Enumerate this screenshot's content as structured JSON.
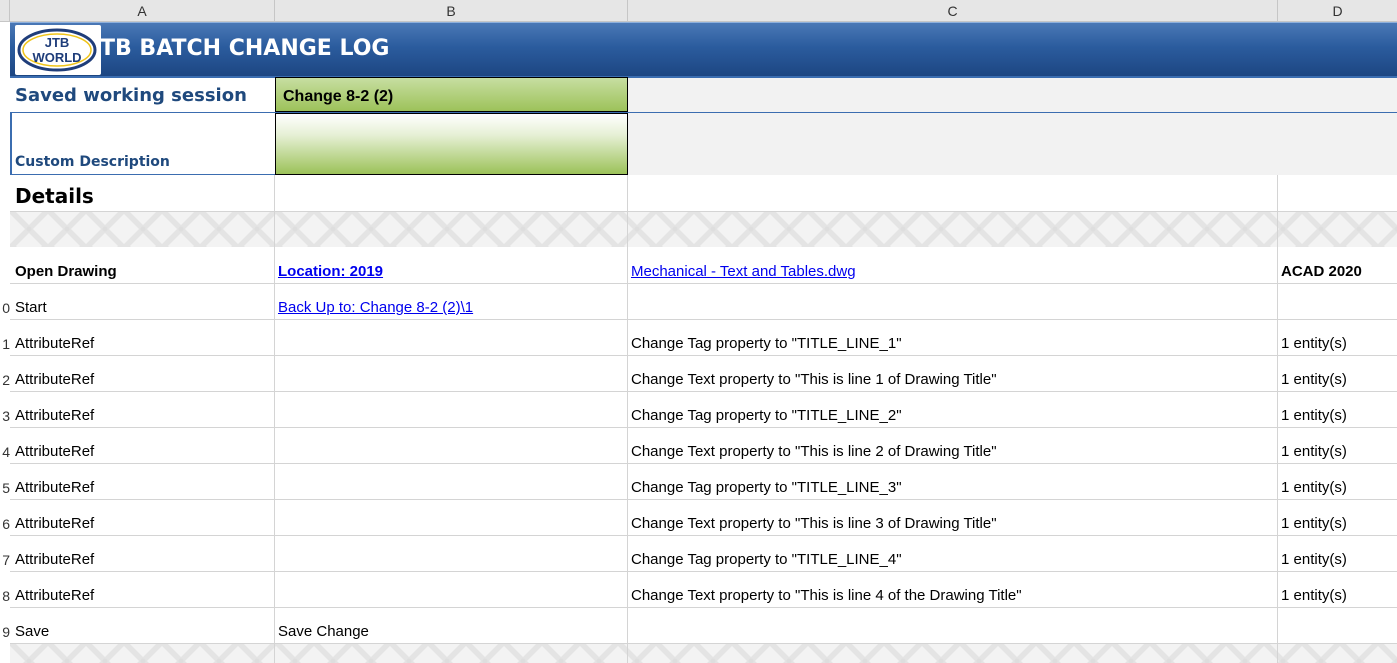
{
  "columns": [
    "A",
    "B",
    "C",
    "D"
  ],
  "banner": {
    "title": "TB BATCH CHANGE LOG",
    "logo_line1": "JTB",
    "logo_line2": "WORLD"
  },
  "session": {
    "label": "Saved working session",
    "value": "Change 8-2 (2)"
  },
  "custom_description": {
    "label": "Custom Description",
    "value": ""
  },
  "details_heading": "Details",
  "open_row": {
    "a": "Open Drawing",
    "b": "Location: 2019",
    "c": "Mechanical - Text and Tables.dwg",
    "d": "ACAD 2020"
  },
  "start_row": {
    "num": "0",
    "a": "Start",
    "b": "Back Up to: Change 8-2 (2)\\1"
  },
  "attr_rows": [
    {
      "num": "1",
      "a": "AttributeRef",
      "c": "Change Tag property to \"TITLE_LINE_1\"",
      "d": "1 entity(s)"
    },
    {
      "num": "2",
      "a": "AttributeRef",
      "c": "Change Text property to \"This is line 1 of Drawing Title\"",
      "d": "1 entity(s)"
    },
    {
      "num": "3",
      "a": "AttributeRef",
      "c": "Change Tag property to \"TITLE_LINE_2\"",
      "d": "1 entity(s)"
    },
    {
      "num": "4",
      "a": "AttributeRef",
      "c": "Change Text property to \"This is line 2 of Drawing Title\"",
      "d": "1 entity(s)"
    },
    {
      "num": "5",
      "a": "AttributeRef",
      "c": "Change Tag property to \"TITLE_LINE_3\"",
      "d": "1 entity(s)"
    },
    {
      "num": "6",
      "a": "AttributeRef",
      "c": "Change Text property to \"This is line 3 of Drawing Title\"",
      "d": "1 entity(s)"
    },
    {
      "num": "7",
      "a": "AttributeRef",
      "c": "Change Tag property to \"TITLE_LINE_4\"",
      "d": "1 entity(s)"
    },
    {
      "num": "8",
      "a": "AttributeRef",
      "c": "Change Text property to \"This is line 4 of the Drawing Title\"",
      "d": "1 entity(s)"
    }
  ],
  "save_row": {
    "num": "9",
    "a": "Save",
    "b": "Save Change"
  },
  "colors": {
    "banner": "#2b5c9e",
    "label_blue": "#1f497d",
    "green": "#9dc25a",
    "link": "#0000ee"
  }
}
